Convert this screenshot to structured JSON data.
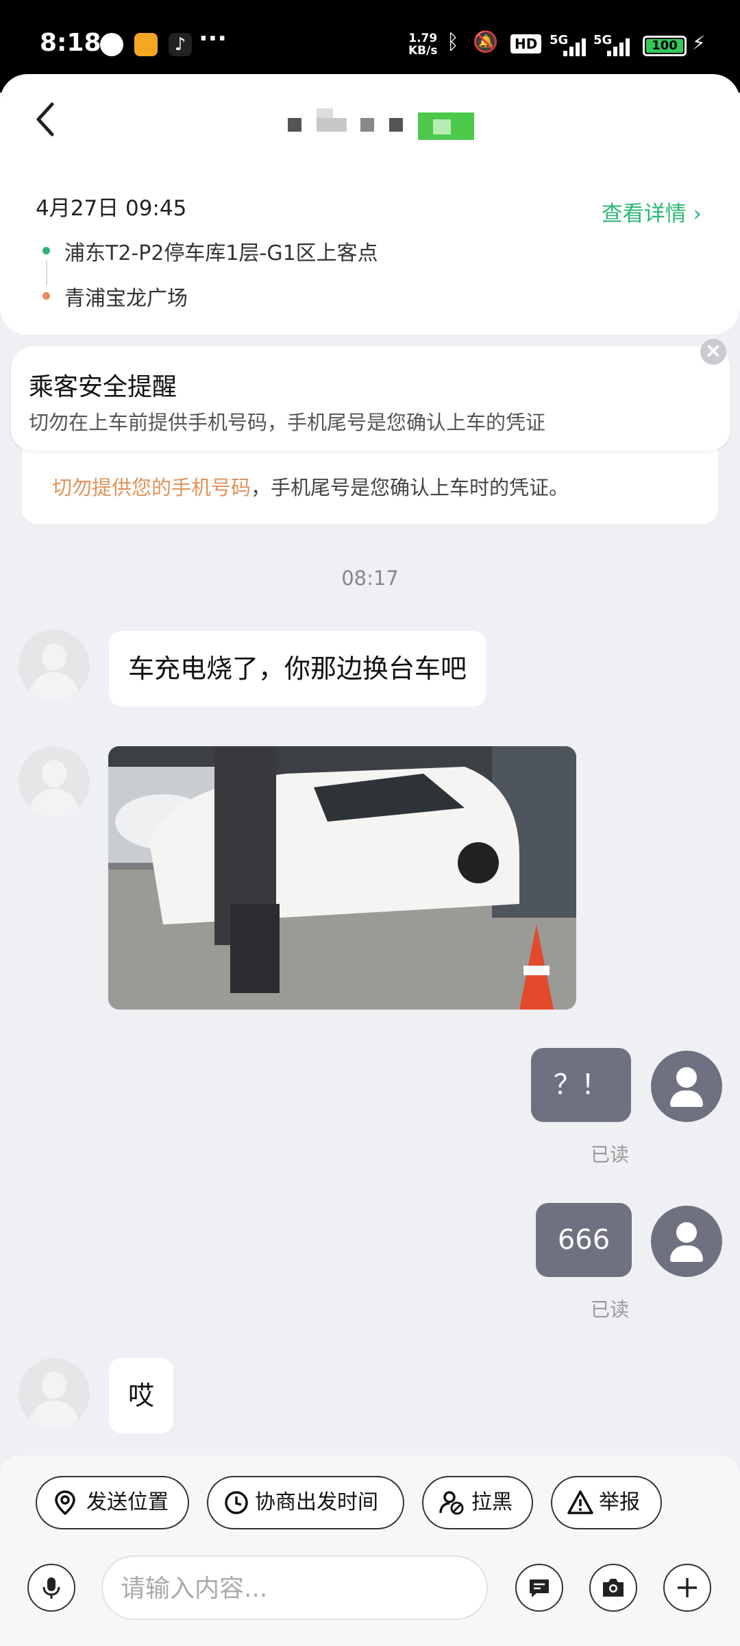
{
  "status_bar": {
    "time": "8:18",
    "net_speed_value": "1.79",
    "net_speed_unit": "KB/s",
    "network_1": "5G",
    "network_2": "5G",
    "battery": "100",
    "colors": {
      "battery_fill": "#34c759"
    }
  },
  "header": {
    "trip_time": "4月27日 09:45",
    "view_details": "查看详情 ›",
    "pickup": "浦东T2-P2停车库1层-G1区上客点",
    "dropoff": "青浦宝龙广场",
    "accent_color": "#2bb673"
  },
  "safety": {
    "title": "乘客安全提醒",
    "text": "切勿在上车前提供手机号码，手机尾号是您确认上车的凭证",
    "back_highlight": "切勿提供您的手机号码",
    "back_rest": "，手机尾号是您确认上车时的凭证。"
  },
  "chat": {
    "timestamp": "08:17",
    "msg1": "车充电烧了，你那边换台车吧",
    "msg2": "？！",
    "msg3": "666",
    "msg4": "哎",
    "read_label": "已读"
  },
  "actions": {
    "send_location": "发送位置",
    "negotiate_time": "协商出发时间",
    "block": "拉黑",
    "report": "举报"
  },
  "input": {
    "placeholder": "请输入内容..."
  }
}
